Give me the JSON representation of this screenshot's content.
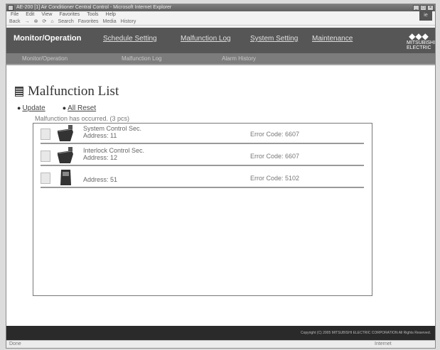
{
  "window": {
    "title": "AE-200 [1] Air Conditioner Central Control - Microsoft Internet Explorer",
    "buttons": [
      "_",
      "□",
      "×"
    ]
  },
  "browser": {
    "menu": [
      "File",
      "Edit",
      "View",
      "Favorites",
      "Tools",
      "Help"
    ],
    "toolbar": [
      "Back",
      "→",
      "⊗",
      "⟳",
      "⌂",
      "Search",
      "Favorites",
      "Media",
      "History"
    ],
    "brand": "ie"
  },
  "nav": {
    "title": "Monitor/Operation",
    "links": [
      "Schedule Setting",
      "Malfunction Log",
      "System Setting",
      "Maintenance"
    ],
    "logo_symbol": "◆◆◆",
    "logo_text": "MITSUBISHI ELECTRIC"
  },
  "subnav": {
    "items": [
      "Monitor/Operation",
      "Malfunction Log",
      "Alarm History"
    ]
  },
  "page": {
    "heading": "Malfunction List",
    "update_label": "Update",
    "all_reset_label": "All Reset",
    "occurred_text": "Malfunction has occurred. (3 pcs)"
  },
  "malfunctions": [
    {
      "name": "System Control Sec.",
      "address": "Address: 11",
      "error": "Error Code: 6607",
      "icon": "indoor-unit-icon"
    },
    {
      "name": "Interlock Control Sec.",
      "address": "Address: 12",
      "error": "Error Code: 6607",
      "icon": "indoor-unit-icon"
    },
    {
      "name": "",
      "address": "Address: 51",
      "error": "Error Code: 5102",
      "icon": "remote-controller-icon"
    }
  ],
  "footer": {
    "copyright": "Copyright (C) 2005 MITSUBISHI ELECTRIC CORPORATION All Rights Reserved."
  },
  "status": {
    "left": "Done",
    "zone": "Internet"
  }
}
